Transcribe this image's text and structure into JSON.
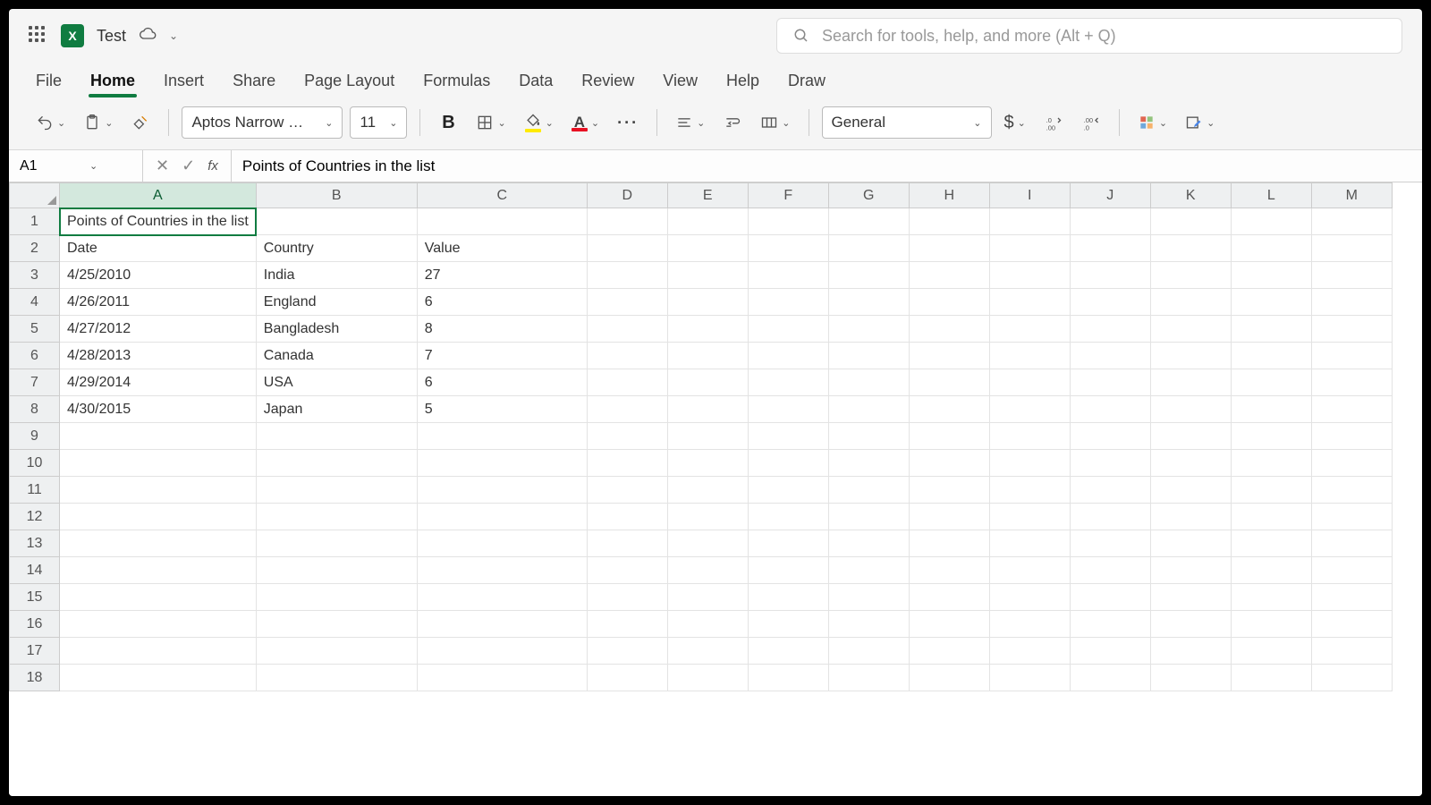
{
  "title": {
    "doc_name": "Test"
  },
  "search": {
    "placeholder": "Search for tools, help, and more (Alt + Q)"
  },
  "tabs": [
    "File",
    "Home",
    "Insert",
    "Share",
    "Page Layout",
    "Formulas",
    "Data",
    "Review",
    "View",
    "Help",
    "Draw"
  ],
  "tabs_active_index": 1,
  "toolbar": {
    "font_name": "Aptos Narrow …",
    "font_size": "11",
    "number_format": "General"
  },
  "formula_bar": {
    "cell_ref": "A1",
    "fx_label": "fx",
    "content": "Points of Countries in the list"
  },
  "columns": [
    "A",
    "B",
    "C",
    "D",
    "E",
    "F",
    "G",
    "H",
    "I",
    "J",
    "K",
    "L",
    "M"
  ],
  "selected_column_index": 0,
  "row_count": 18,
  "selected_cell": {
    "row": 1,
    "col": 0
  },
  "cells": {
    "1": {
      "A": "Points of Countries in the list"
    },
    "2": {
      "A": "Date",
      "B": "Country",
      "C": "Value"
    },
    "3": {
      "A": "4/25/2010",
      "B": "India",
      "C": "27"
    },
    "4": {
      "A": "4/26/2011",
      "B": "England",
      "C": "6"
    },
    "5": {
      "A": "4/27/2012",
      "B": "Bangladesh",
      "C": "8"
    },
    "6": {
      "A": "4/28/2013",
      "B": "Canada",
      "C": "7"
    },
    "7": {
      "A": "4/29/2014",
      "B": "USA",
      "C": "6"
    },
    "8": {
      "A": "4/30/2015",
      "B": "Japan",
      "C": "5"
    }
  },
  "chart_data": {
    "type": "table",
    "title": "Points of Countries in the list",
    "columns": [
      "Date",
      "Country",
      "Value"
    ],
    "rows": [
      [
        "4/25/2010",
        "India",
        27
      ],
      [
        "4/26/2011",
        "England",
        6
      ],
      [
        "4/27/2012",
        "Bangladesh",
        8
      ],
      [
        "4/28/2013",
        "Canada",
        7
      ],
      [
        "4/29/2014",
        "USA",
        6
      ],
      [
        "4/30/2015",
        "Japan",
        5
      ]
    ]
  }
}
